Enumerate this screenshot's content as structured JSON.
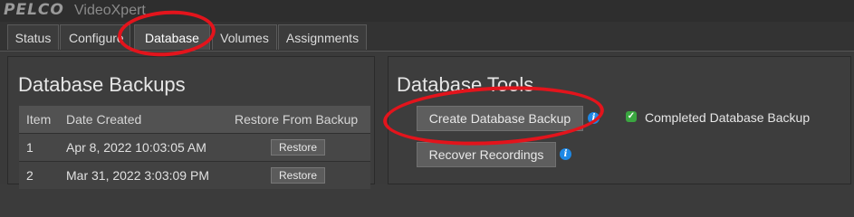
{
  "app": {
    "brand": "PELCO",
    "name": "VideoXpert"
  },
  "tabs": [
    {
      "label": "Status"
    },
    {
      "label": "Configure"
    },
    {
      "label": "Database",
      "active": true
    },
    {
      "label": "Volumes"
    },
    {
      "label": "Assignments"
    }
  ],
  "backups": {
    "title": "Database Backups",
    "columns": {
      "item": "Item",
      "date": "Date Created",
      "restore": "Restore From Backup"
    },
    "rows": [
      {
        "item": "1",
        "date": "Apr 8, 2022 10:03:05 AM",
        "action": "Restore"
      },
      {
        "item": "2",
        "date": "Mar 31, 2022 3:03:09 PM",
        "action": "Restore"
      }
    ]
  },
  "tools": {
    "title": "Database Tools",
    "create_label": "Create Database Backup",
    "recover_label": "Recover Recordings",
    "status_text": "Completed Database Backup"
  },
  "icons": {
    "info": "info-icon",
    "check": "check-icon"
  },
  "colors": {
    "annotation": "#e3141c",
    "info": "#1e88e5",
    "success": "#3aa640"
  }
}
